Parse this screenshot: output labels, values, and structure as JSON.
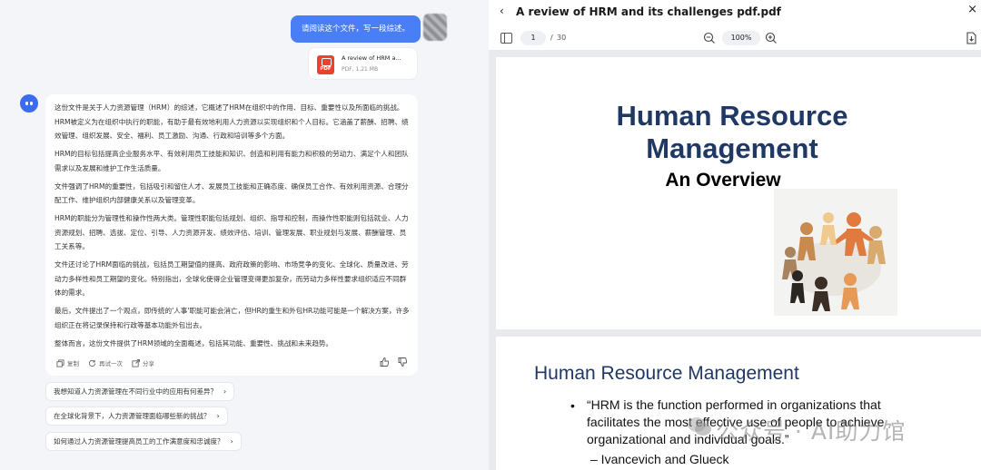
{
  "chat": {
    "user_message": "请阅读这个文件，写一段综述。",
    "attachment": {
      "name": "A review of HRM a...",
      "meta": "PDF, 1.21 MB",
      "badge": "PDF"
    },
    "answer_paragraphs": [
      "这份文件是关于人力资源管理（HRM）的综述，它概述了HRM在组织中的作用、目标、重要性以及所面临的挑战。HRM被定义为在组织中执行的职能，有助于最有效地利用人力资源以实现组织和个人目标。它涵盖了薪酬、招聘、绩效管理、组织发展、安全、福利、员工激励、沟通、行政和培训等多个方面。",
      "HRM的目标包括提高企业服务水平、有效利用员工技能和知识、创造和利用有能力和积极的劳动力、满足个人和团队需求以及发展和维护工作生活质量。",
      "文件强调了HRM的重要性，包括吸引和留住人才、发展员工技能和正确态度、确保员工合作、有效利用资源、合理分配工作、维护组织内部健康关系以及管理变革。",
      "HRM的职能分为管理性和操作性两大类。管理性职能包括规划、组织、指导和控制，而操作性职能则包括就业、人力资源规划、招聘、选拔、定位、引导、人力资源开发、绩效评估、培训、管理发展、职业规划与发展、薪酬管理、员工关系等。",
      "文件还讨论了HRM面临的挑战，包括员工期望值的提高、政府政策的影响、市场竞争的变化、全球化、质量改进、劳动力多样性和员工期望的变化。特别指出，全球化使得企业管理变得更加复杂，而劳动力多样性要求组织适应不同群体的需求。",
      "最后，文件提出了一个观点，即传统的'人事'职能可能会消亡，但HR的重生和外包HR功能可能是一个解决方案，许多组织正在将记录保持和行政等基本功能外包出去。",
      "整体而言，这份文件提供了HRM领域的全面概述，包括其功能、重要性、挑战和未来趋势。"
    ],
    "actions": {
      "copy": "复制",
      "retry": "再试一次",
      "share": "分享"
    },
    "suggestions": [
      "我想知道人力资源管理在不同行业中的应用有何差异？",
      "在全球化背景下，人力资源管理面临哪些新的挑战？",
      "如何通过人力资源管理提高员工的工作满意度和忠诚度？"
    ]
  },
  "viewer": {
    "title": "A review of HRM and its challenges pdf.pdf",
    "page_current": "1",
    "page_sep": "/",
    "page_total": "30",
    "zoom": "100%",
    "page1": {
      "title_line1": "Human Resource",
      "title_line2": "Management",
      "subtitle": "An Overview"
    },
    "page2": {
      "title": "Human Resource Management",
      "bullet": "•",
      "quote": "“HRM is the function performed in organizations that facilitates the most effective use of people to achieve organizational and individual goals.”",
      "author": "– Ivancevich and Glueck"
    }
  },
  "watermark": "公众号 · AI助力馆",
  "colors": {
    "accent": "#4a7ef7",
    "slide_title": "#1f3864",
    "pdf_red": "#e9432f"
  }
}
